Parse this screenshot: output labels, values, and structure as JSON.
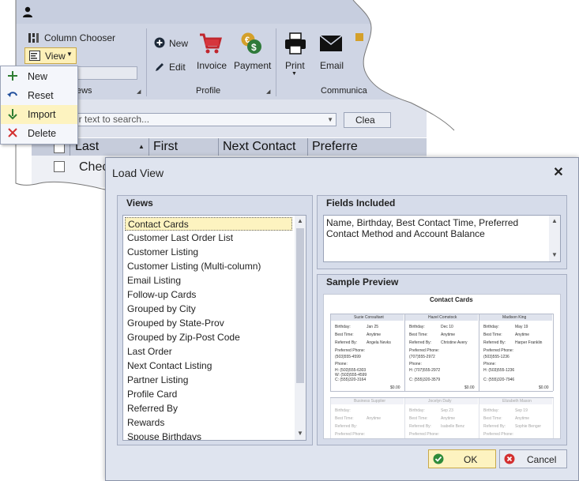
{
  "app": {
    "ribbon": {
      "column_chooser": "Column Chooser",
      "view_button": "View",
      "views_group": "ews",
      "new": "New",
      "edit": "Edit",
      "invoice": "Invoice",
      "payment": "Payment",
      "profile_group": "Profile",
      "print": "Print",
      "email": "Email",
      "communication_group": "Communica"
    },
    "search": {
      "placeholder": "er text to search...",
      "clear": "Clea"
    },
    "grid": {
      "columns": [
        "Last",
        "First",
        "Next Contact",
        "Preferre"
      ],
      "first_row_last": "Chec"
    }
  },
  "view_menu": {
    "items": [
      {
        "label": "New",
        "icon": "plus-icon"
      },
      {
        "label": "Reset",
        "icon": "undo-icon"
      },
      {
        "label": "Import",
        "icon": "arrow-down-icon"
      },
      {
        "label": "Delete",
        "icon": "x-icon"
      }
    ]
  },
  "dialog": {
    "title": "Load View",
    "views_title": "Views",
    "views": [
      "Contact Cards",
      "Customer Last Order List",
      "Customer Listing",
      "Customer Listing (Multi-column)",
      "Email Listing",
      "Follow-up Cards",
      "Grouped by City",
      "Grouped by State-Prov",
      "Grouped by Zip-Post Code",
      "Last Order",
      "Next Contact Listing",
      "Partner Listing",
      "Profile Card",
      "Referred By",
      "Rewards",
      "Spouse Birthdays"
    ],
    "selected_view": "Contact Cards",
    "fields_title": "Fields Included",
    "fields_text": "Name, Birthday, Best Contact Time, Preferred Contact Method and Account Balance",
    "preview_title": "Sample Preview",
    "ok": "OK",
    "cancel": "Cancel"
  },
  "preview": {
    "title": "Contact Cards",
    "cards": [
      {
        "name": "Suzie  Consultant",
        "birthday": "Jan 25",
        "best_time": "Anytime",
        "referred": "Angela Nevks",
        "phone": "(503)555-4599",
        "h": "H: (503)555-6303",
        "w": "W: (503)555-4599",
        "c": "C: (555)320-3164",
        "balance": "$0.00"
      },
      {
        "name": "Hazel Comstock",
        "birthday": "Dec 10",
        "best_time": "Anytime",
        "referred": "Christine Avery",
        "phone": "(707)555-2972",
        "h": "H: (707)555-2972",
        "w": "",
        "c": "C: (555)320-3579",
        "balance": "$0.00"
      },
      {
        "name": "Madison King",
        "birthday": "May 19",
        "best_time": "Anytime",
        "referred": "Harper Franklin",
        "phone": "(503)555-1236",
        "h": "H: (503)555-1236",
        "w": "",
        "c": "C: (555)320-7946",
        "balance": "$0.00"
      }
    ],
    "cards2": [
      {
        "name": "Business  Supplier",
        "birthday": "",
        "best_time": "Anytime"
      },
      {
        "name": "Jocelyn Daily",
        "birthday": "Sep 23",
        "best_time": "Anytime",
        "referred": "Isabelle Benz"
      },
      {
        "name": "Elizabeth Mason",
        "birthday": "Sep 19",
        "best_time": "Anytime",
        "referred": "Sophie Benger"
      }
    ],
    "labels": {
      "birthday": "Birthday:",
      "best_time": "Best Time:",
      "referred": "Referred By:",
      "pref_phone": "Preferred Phone:",
      "phone": "Phone:"
    }
  }
}
